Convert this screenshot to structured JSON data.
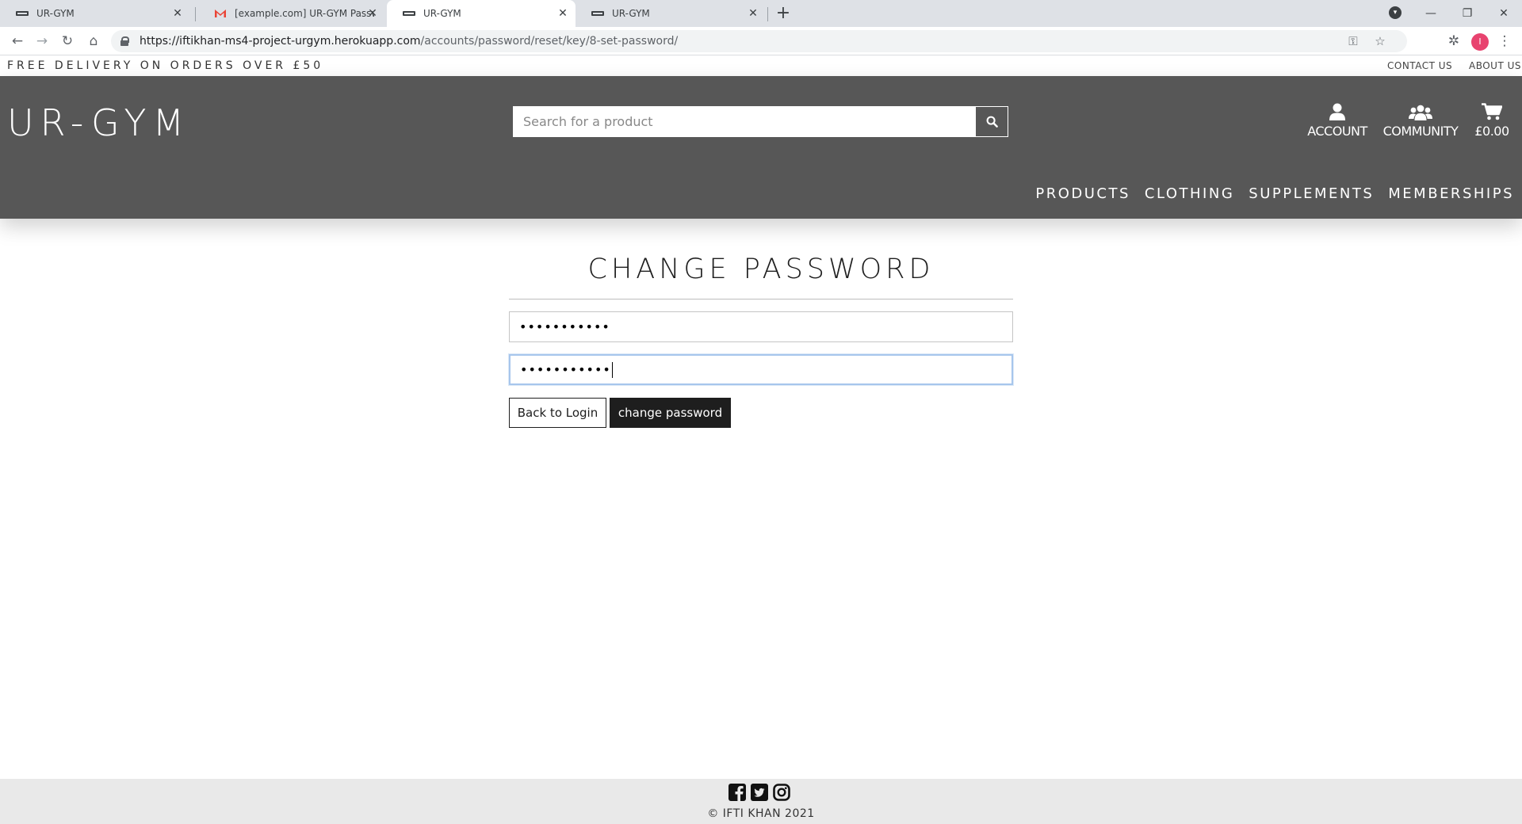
{
  "browser": {
    "tabs": [
      {
        "title": "UR-GYM",
        "active": false
      },
      {
        "title": "[example.com] UR-GYM Password Reset",
        "active": false
      },
      {
        "title": "UR-GYM",
        "active": true
      },
      {
        "title": "UR-GYM",
        "active": false
      }
    ],
    "url_host": "https://iftikhan-ms4-project-urgym.herokuapp.com",
    "url_path": "/accounts/password/reset/key/8-set-password/",
    "profile_initial": "I"
  },
  "banner": {
    "delivery": "FREE DELIVERY ON ORDERS OVER £50",
    "contact": "CONTACT US",
    "about": "ABOUT US"
  },
  "header": {
    "logo": "UR-GYM",
    "search_placeholder": "Search for a product",
    "account": "ACCOUNT",
    "community": "COMMUNITY",
    "cart_total": "£0.00",
    "nav": [
      "PRODUCTS",
      "CLOTHING",
      "SUPPLEMENTS",
      "MEMBERSHIPS"
    ]
  },
  "form": {
    "title": "CHANGE PASSWORD",
    "password1": "•••••••••••",
    "password2": "•••••••••••",
    "back_label": "Back to Login",
    "submit_label": "change password"
  },
  "footer": {
    "copyright": "© IFTI KHAN 2021"
  },
  "colors": {
    "header_bg": "#575757",
    "button_dark": "#1e1e1e",
    "footer_bg": "#e9e9e9",
    "focus_ring": "#a7c6ec"
  }
}
